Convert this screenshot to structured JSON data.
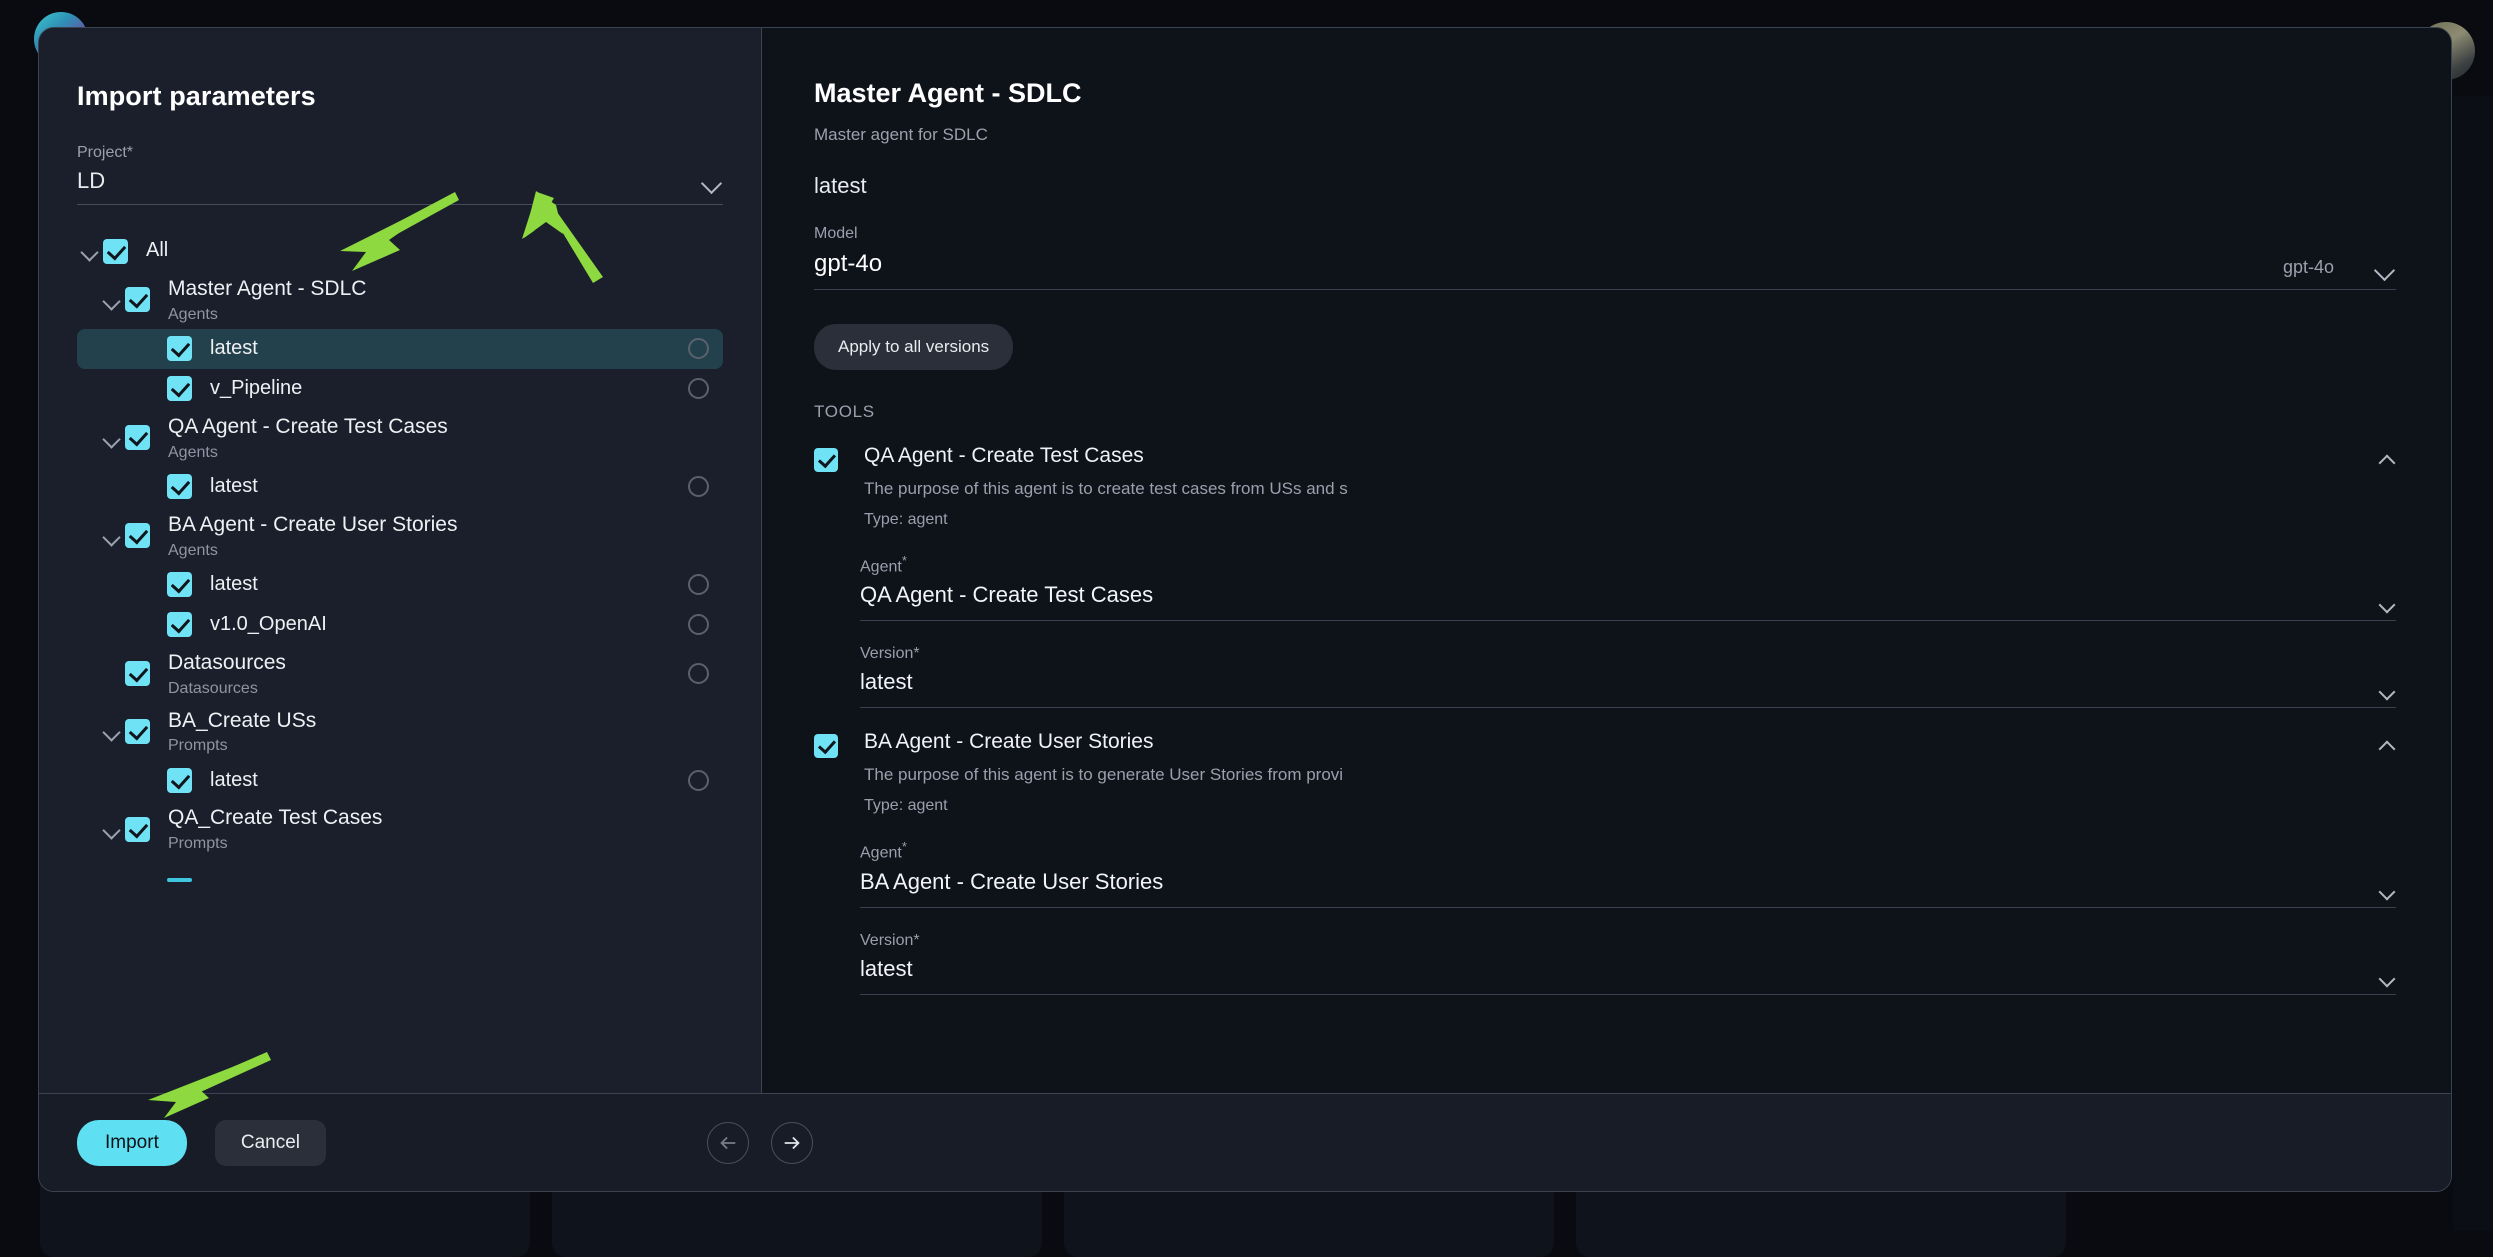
{
  "modal": {
    "left": {
      "title": "Import parameters",
      "project_field": {
        "label": "Project*",
        "value": "LD"
      },
      "tree": [
        {
          "label": "All",
          "sub": "",
          "indent": 0,
          "twisty": true,
          "checked": true,
          "radio": false,
          "selected": false
        },
        {
          "label": "Master Agent - SDLC",
          "sub": "Agents",
          "indent": 1,
          "twisty": true,
          "checked": true,
          "radio": false,
          "selected": false
        },
        {
          "label": "latest",
          "sub": "",
          "indent": 2,
          "twisty": false,
          "checked": true,
          "radio": true,
          "selected": true
        },
        {
          "label": "v_Pipeline",
          "sub": "",
          "indent": 2,
          "twisty": false,
          "checked": true,
          "radio": true,
          "selected": false
        },
        {
          "label": "QA Agent - Create Test Cases",
          "sub": "Agents",
          "indent": 1,
          "twisty": true,
          "checked": true,
          "radio": false,
          "selected": false
        },
        {
          "label": "latest",
          "sub": "",
          "indent": 2,
          "twisty": false,
          "checked": true,
          "radio": true,
          "selected": false
        },
        {
          "label": "BA Agent - Create User Stories",
          "sub": "Agents",
          "indent": 1,
          "twisty": true,
          "checked": true,
          "radio": false,
          "selected": false
        },
        {
          "label": "latest",
          "sub": "",
          "indent": 2,
          "twisty": false,
          "checked": true,
          "radio": true,
          "selected": false
        },
        {
          "label": "v1.0_OpenAI",
          "sub": "",
          "indent": 2,
          "twisty": false,
          "checked": true,
          "radio": true,
          "selected": false
        },
        {
          "label": "Datasources",
          "sub": "Datasources",
          "indent": 1,
          "twisty": false,
          "checked": true,
          "radio": true,
          "selected": false
        },
        {
          "label": "BA_Create USs",
          "sub": "Prompts",
          "indent": 1,
          "twisty": true,
          "checked": true,
          "radio": false,
          "selected": false
        },
        {
          "label": "latest",
          "sub": "",
          "indent": 2,
          "twisty": false,
          "checked": true,
          "radio": true,
          "selected": false
        },
        {
          "label": "QA_Create Test Cases",
          "sub": "Prompts",
          "indent": 1,
          "twisty": true,
          "checked": true,
          "radio": false,
          "selected": false
        }
      ]
    },
    "right": {
      "title": "Master Agent - SDLC",
      "description": "Master agent for SDLC",
      "version": "latest",
      "model_field": {
        "label": "Model",
        "value": "gpt-4o",
        "hint": "gpt-4o"
      },
      "apply_button": "Apply to all versions",
      "tools_heading": "TOOLS",
      "tools": [
        {
          "checked": true,
          "name": "QA Agent - Create Test Cases",
          "description": "The purpose of this agent is to create test cases from USs and s",
          "type": "Type: agent",
          "expanded": true,
          "agent_label": "Agent",
          "agent_value": "QA Agent - Create Test Cases",
          "version_label": "Version*",
          "version_value": "latest"
        },
        {
          "checked": true,
          "name": "BA Agent - Create User Stories",
          "description": "The purpose of this agent is to generate User Stories from provi",
          "type": "Type: agent",
          "expanded": true,
          "agent_label": "Agent",
          "agent_value": "BA Agent - Create User Stories",
          "version_label": "Version*",
          "version_value": "latest"
        }
      ]
    },
    "footer": {
      "import_label": "Import",
      "cancel_label": "Cancel",
      "prev_icon": "arrow-left-icon",
      "next_icon": "arrow-right-icon"
    }
  },
  "colors": {
    "accent": "#6fe3f5",
    "modal_bg": "#0e1219",
    "left_panel_bg": "#1a1f2b",
    "selected_row": "#23414c",
    "annotation_green": "#8dd93f"
  },
  "annotations": {
    "arrow_count": 3,
    "color": "#8dd93f"
  }
}
